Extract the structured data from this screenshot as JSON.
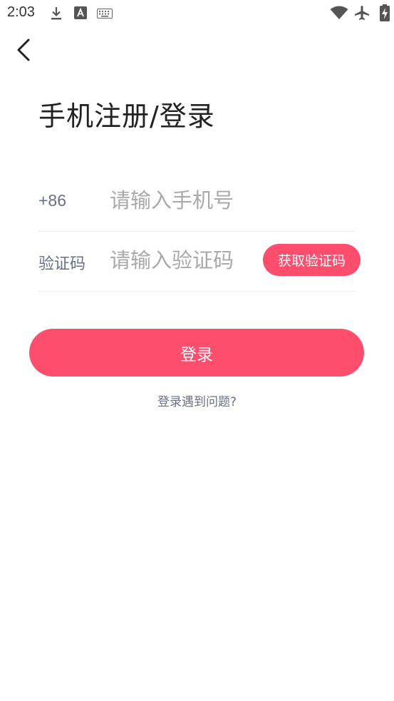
{
  "status_bar": {
    "time": "2:03",
    "icons": [
      "download-icon",
      "a-box-icon",
      "keyboard-icon",
      "wifi-icon",
      "airplane-icon",
      "battery-charging-icon"
    ]
  },
  "header": {
    "back_icon": "chevron-left-icon",
    "title": "手机注册/登录"
  },
  "form": {
    "phone": {
      "prefix": "+86",
      "placeholder": "请输入手机号"
    },
    "code": {
      "label": "验证码",
      "placeholder": "请输入验证码",
      "get_code_label": "获取验证码"
    },
    "login_label": "登录",
    "help_label": "登录遇到问题?"
  },
  "colors": {
    "accent": "#ff4d6d",
    "label": "#6a6e88",
    "placeholder": "#a9a9a9",
    "title": "#222222"
  }
}
